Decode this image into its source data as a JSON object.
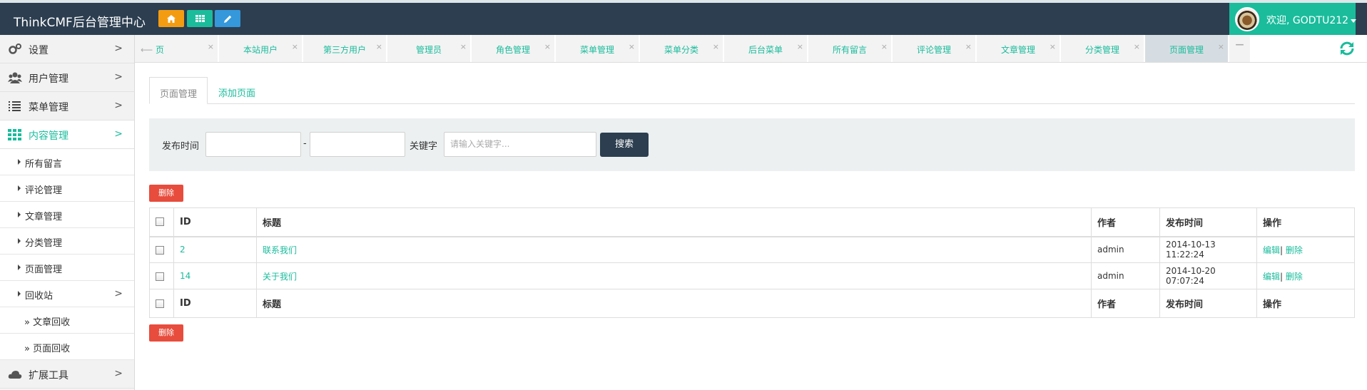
{
  "app": {
    "title": "ThinkCMF后台管理中心",
    "welcome": "欢迎, GODTU212"
  },
  "colors": {
    "accent": "#1abc9c",
    "header": "#2c3e50",
    "danger": "#e74c3c",
    "home_btn": "#f39c12",
    "grid_btn": "#1abc9c",
    "edit_btn": "#3498db"
  },
  "quick_buttons": [
    {
      "icon": "home-icon"
    },
    {
      "icon": "grid-icon"
    },
    {
      "icon": "pencil-icon"
    }
  ],
  "sidebar": {
    "items": [
      {
        "label": "设置",
        "icon": "gears-icon"
      },
      {
        "label": "用户管理",
        "icon": "users-icon"
      },
      {
        "label": "菜单管理",
        "icon": "list-icon"
      },
      {
        "label": "内容管理",
        "icon": "grid-icon",
        "active": true
      }
    ],
    "sub_items": [
      {
        "label": "所有留言"
      },
      {
        "label": "评论管理"
      },
      {
        "label": "文章管理"
      },
      {
        "label": "分类管理"
      },
      {
        "label": "页面管理"
      },
      {
        "label": "回收站"
      }
    ],
    "recycle_items": [
      {
        "label": "» 文章回收"
      },
      {
        "label": "» 页面回收"
      }
    ],
    "bottom_item": {
      "label": "扩展工具",
      "icon": "cloud-icon"
    },
    "arrow": ">"
  },
  "page_tabs": [
    {
      "label": "页",
      "prefix": "⟵"
    },
    {
      "label": "本站用户"
    },
    {
      "label": "第三方用户"
    },
    {
      "label": "管理员"
    },
    {
      "label": "角色管理"
    },
    {
      "label": "菜单管理"
    },
    {
      "label": "菜单分类"
    },
    {
      "label": "后台菜单"
    },
    {
      "label": "所有留言"
    },
    {
      "label": "评论管理"
    },
    {
      "label": "文章管理"
    },
    {
      "label": "分类管理"
    },
    {
      "label": "页面管理",
      "active": true
    }
  ],
  "tab_close": "×",
  "content_tabs": {
    "active": "页面管理",
    "add": "添加页面"
  },
  "filter": {
    "date_label": "发布时间",
    "separator": "-",
    "keyword_label": "关键字",
    "keyword_placeholder": "请输入关键字...",
    "search_button": "搜索"
  },
  "delete_button": "删除",
  "table": {
    "headers": {
      "id": "ID",
      "title": "标题",
      "author": "作者",
      "time": "发布时间",
      "ops": "操作"
    },
    "rows": [
      {
        "id": "2",
        "title": "联系我们",
        "author": "admin",
        "time": "2014-10-13 11:22:24",
        "edit": "编辑",
        "sep": "|",
        "delete": "删除"
      },
      {
        "id": "14",
        "title": "关于我们",
        "author": "admin",
        "time": "2014-10-20 07:07:24",
        "edit": "编辑",
        "sep": "|",
        "delete": "删除"
      }
    ]
  }
}
